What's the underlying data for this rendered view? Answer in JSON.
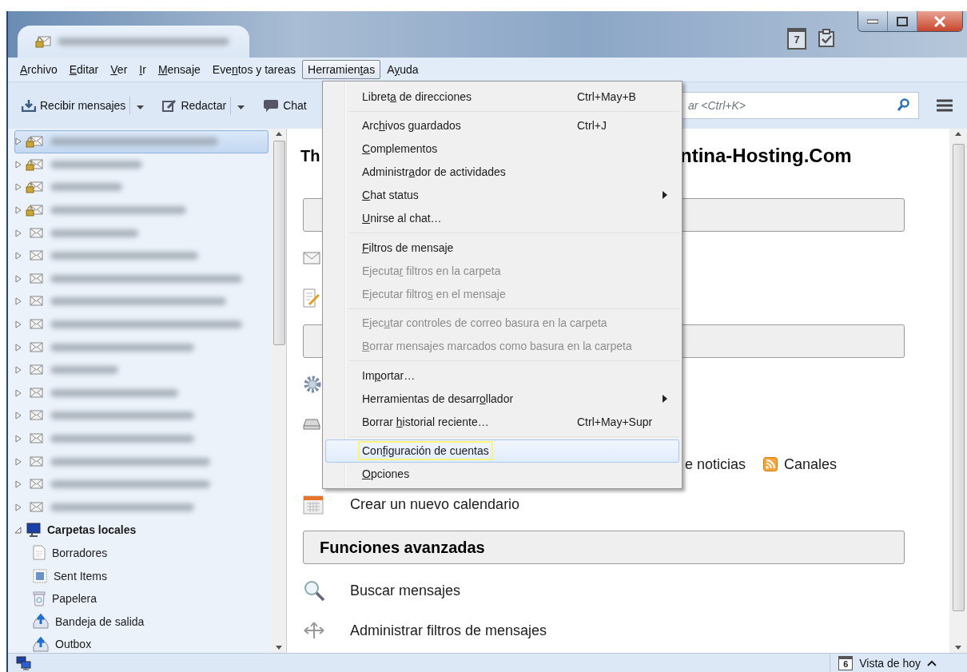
{
  "title_bar": {
    "calendar_day": "7"
  },
  "menu_bar": [
    {
      "label": {
        "key": "A",
        "post": "rchivo"
      },
      "selected": false
    },
    {
      "label": {
        "key": "E",
        "post": "ditar"
      },
      "selected": false
    },
    {
      "label": {
        "key": "V",
        "post": "er"
      },
      "selected": false
    },
    {
      "label": {
        "key": "I",
        "post": "r"
      },
      "selected": false
    },
    {
      "label": {
        "key": "M",
        "post": "ensaje"
      },
      "selected": false
    },
    {
      "label": {
        "pre": "Eve",
        "key": "n",
        "post": "tos y tareas"
      },
      "selected": false
    },
    {
      "label": {
        "pre": "Herramien",
        "key": "t",
        "post": "as"
      },
      "selected": true
    },
    {
      "label": {
        "pre": "A",
        "key": "y",
        "post": "uda"
      },
      "selected": false
    }
  ],
  "toolbar": {
    "buttons": [
      {
        "kind": "get",
        "label": "Recibir mensajes",
        "dropdown": true
      },
      {
        "kind": "write",
        "label": "Redactar",
        "dropdown": true
      },
      {
        "kind": "chat",
        "label": "Chat",
        "dropdown": false
      }
    ],
    "search": {
      "placeholder": "ar <Ctrl+K>"
    }
  },
  "folders": {
    "accounts": [
      {
        "secure": true,
        "selected": true,
        "expanded": false
      },
      {
        "secure": true,
        "selected": false,
        "expanded": false
      },
      {
        "secure": true,
        "selected": false,
        "expanded": false
      },
      {
        "secure": true,
        "selected": false,
        "expanded": false
      },
      {
        "secure": false,
        "selected": false,
        "expanded": false
      },
      {
        "secure": false,
        "selected": false,
        "expanded": false
      },
      {
        "secure": false,
        "selected": false,
        "expanded": false
      },
      {
        "secure": false,
        "selected": false,
        "expanded": false
      },
      {
        "secure": false,
        "selected": false,
        "expanded": false
      },
      {
        "secure": false,
        "selected": false,
        "expanded": false
      },
      {
        "secure": false,
        "selected": false,
        "expanded": false
      },
      {
        "secure": false,
        "selected": false,
        "expanded": false
      },
      {
        "secure": false,
        "selected": false,
        "expanded": false
      },
      {
        "secure": false,
        "selected": false,
        "expanded": false
      },
      {
        "secure": false,
        "selected": false,
        "expanded": false
      },
      {
        "secure": false,
        "selected": false,
        "expanded": false
      },
      {
        "secure": false,
        "selected": false,
        "expanded": false
      }
    ],
    "local": {
      "label": "Carpetas locales",
      "expanded": true,
      "children": [
        {
          "label": "Borradores",
          "kind": "drafts"
        },
        {
          "label": "Sent Items",
          "kind": "sent"
        },
        {
          "label": "Papelera",
          "kind": "trash"
        },
        {
          "label": "Bandeja de salida",
          "kind": "outbox"
        },
        {
          "label": "Outbox",
          "kind": "outbox"
        }
      ]
    }
  },
  "content": [
    {
      "kind": "heading",
      "parts": [
        "Th",
        "ntina-Hosting.Com"
      ]
    },
    {
      "kind": "section"
    },
    {
      "kind": "mail"
    },
    {
      "kind": "compose"
    },
    {
      "kind": "section"
    },
    {
      "kind": "settings"
    },
    {
      "kind": "storage"
    },
    {
      "kind": "feeds",
      "label": "e noticias",
      "extra": "Canales"
    },
    {
      "kind": "calendar",
      "label": "Crear un nuevo calendario"
    },
    {
      "kind": "section",
      "title": "Funciones avanzadas"
    },
    {
      "kind": "search",
      "label": "Buscar mensajes"
    },
    {
      "kind": "filters",
      "label": "Administrar filtros de mensajes"
    }
  ],
  "tools_menu": {
    "items": [
      {
        "kind": "item",
        "label": {
          "pre": "Libret",
          "key": "a",
          "post": " de direcciones"
        },
        "shortcut": "Ctrl+May+B",
        "disabled": false,
        "submenu": false,
        "selected": false
      },
      {
        "kind": "separator"
      },
      {
        "kind": "item",
        "label": {
          "pre": "Arc",
          "key": "h",
          "post": "ivos guardados"
        },
        "shortcut": "Ctrl+J",
        "disabled": false,
        "submenu": false,
        "selected": false
      },
      {
        "kind": "item",
        "label": {
          "key": "C",
          "post": "omplementos"
        },
        "disabled": false,
        "submenu": false,
        "selected": false
      },
      {
        "kind": "item",
        "label": {
          "pre": "Administr",
          "key": "a",
          "post": "dor de actividades"
        },
        "disabled": false,
        "submenu": false,
        "selected": false
      },
      {
        "kind": "item",
        "label": {
          "key": "C",
          "post": "hat status"
        },
        "disabled": false,
        "submenu": true,
        "selected": false
      },
      {
        "kind": "item",
        "label": {
          "key": "U",
          "post": "nirse al chat…"
        },
        "disabled": false,
        "submenu": false,
        "selected": false
      },
      {
        "kind": "separator"
      },
      {
        "kind": "item",
        "label": {
          "key": "F",
          "post": "iltros de mensaje"
        },
        "disabled": false,
        "submenu": false,
        "selected": false
      },
      {
        "kind": "item",
        "label": {
          "pre": "Ejecuta",
          "key": "r",
          "post": " filtros en la carpeta"
        },
        "disabled": true,
        "submenu": false,
        "selected": false
      },
      {
        "kind": "item",
        "label": {
          "pre": "Ejecutar filtro",
          "key": "s",
          "post": " en el mensaje"
        },
        "disabled": true,
        "submenu": false,
        "selected": false
      },
      {
        "kind": "separator"
      },
      {
        "kind": "item",
        "label": {
          "pre": "Ejec",
          "key": "u",
          "post": "tar controles de correo basura en la carpeta"
        },
        "disabled": true,
        "submenu": false,
        "selected": false
      },
      {
        "kind": "item",
        "label": {
          "key": "B",
          "post": "orrar mensajes marcados como basura en la carpeta"
        },
        "disabled": true,
        "submenu": false,
        "selected": false
      },
      {
        "kind": "separator"
      },
      {
        "kind": "item",
        "label": {
          "pre": "Im",
          "key": "p",
          "post": "ortar…"
        },
        "disabled": false,
        "submenu": false,
        "selected": false
      },
      {
        "kind": "item",
        "label": {
          "pre": "Herramientas de desarr",
          "key": "o",
          "post": "llador"
        },
        "disabled": false,
        "submenu": true,
        "selected": false
      },
      {
        "kind": "item",
        "label": {
          "pre": "Borrar ",
          "key": "h",
          "post": "istorial reciente…"
        },
        "shortcut": "Ctrl+May+Supr",
        "disabled": false,
        "submenu": false,
        "selected": false
      },
      {
        "kind": "separator"
      },
      {
        "kind": "item",
        "label": {
          "pre": "Con",
          "key": "f",
          "post": "iguración de cuentas"
        },
        "disabled": false,
        "submenu": false,
        "selected": true
      },
      {
        "kind": "item",
        "label": {
          "key": "O",
          "post": "pciones"
        },
        "disabled": false,
        "submenu": false,
        "selected": false
      }
    ]
  },
  "status_bar": {
    "today_day": "6",
    "label": "Vista de hoy"
  }
}
